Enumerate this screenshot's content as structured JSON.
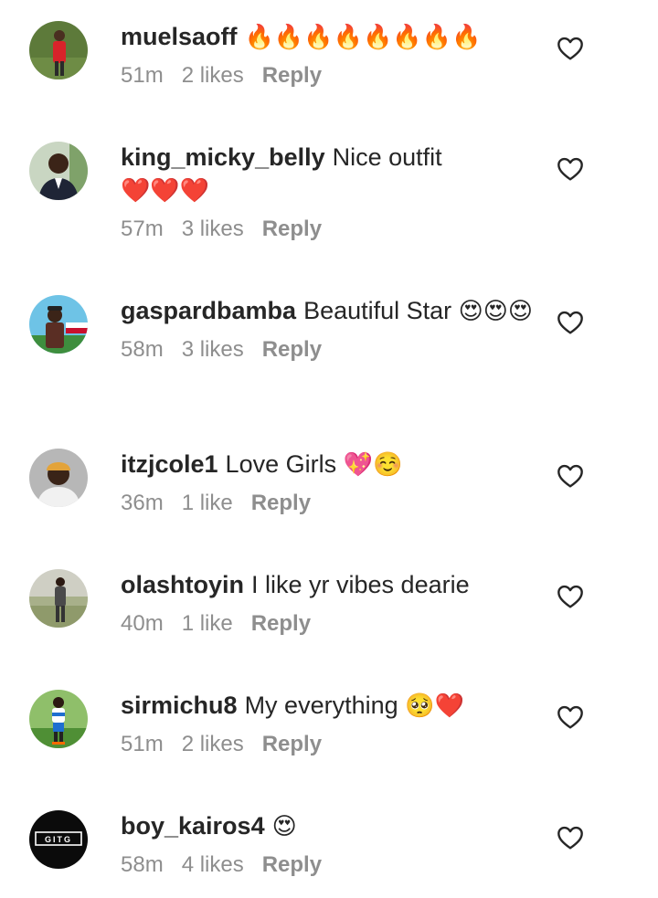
{
  "comments": [
    {
      "username": "muelsaoff",
      "text": "",
      "emoji": "🔥🔥🔥🔥🔥🔥🔥🔥",
      "time": "51m",
      "likes": "2 likes",
      "reply_label": "Reply",
      "avatar_icon": "avatar-person-red-shirt"
    },
    {
      "username": "king_micky_belly",
      "text": "Nice outfit",
      "emoji": "❤️❤️❤️",
      "time": "57m",
      "likes": "3 likes",
      "reply_label": "Reply",
      "avatar_icon": "avatar-person-suit"
    },
    {
      "username": "gaspardbamba",
      "text": "Beautiful Star",
      "emoji": "😍😍😍",
      "time": "58m",
      "likes": "3 likes",
      "reply_label": "Reply",
      "avatar_icon": "avatar-person-cap"
    },
    {
      "username": "itzjcole1",
      "text": "Love Girls",
      "emoji": "💖☺️",
      "time": "36m",
      "likes": "1 like",
      "reply_label": "Reply",
      "avatar_icon": "avatar-person-beanie"
    },
    {
      "username": "olashtoyin",
      "text": "I like yr vibes dearie",
      "emoji": "",
      "time": "40m",
      "likes": "1 like",
      "reply_label": "Reply",
      "avatar_icon": "avatar-person-outdoor"
    },
    {
      "username": "sirmichu8",
      "text": "My everything",
      "emoji": "🥺❤️",
      "time": "51m",
      "likes": "2 likes",
      "reply_label": "Reply",
      "avatar_icon": "avatar-person-field"
    },
    {
      "username": "boy_kairos4",
      "text": "",
      "emoji": "😍",
      "time": "58m",
      "likes": "4 likes",
      "reply_label": "Reply",
      "avatar_icon": "avatar-logo-gitg",
      "avatar_logo_text": "GITG"
    }
  ],
  "colors": {
    "text": "#262626",
    "secondary": "#8e8e8e",
    "background": "#ffffff"
  }
}
